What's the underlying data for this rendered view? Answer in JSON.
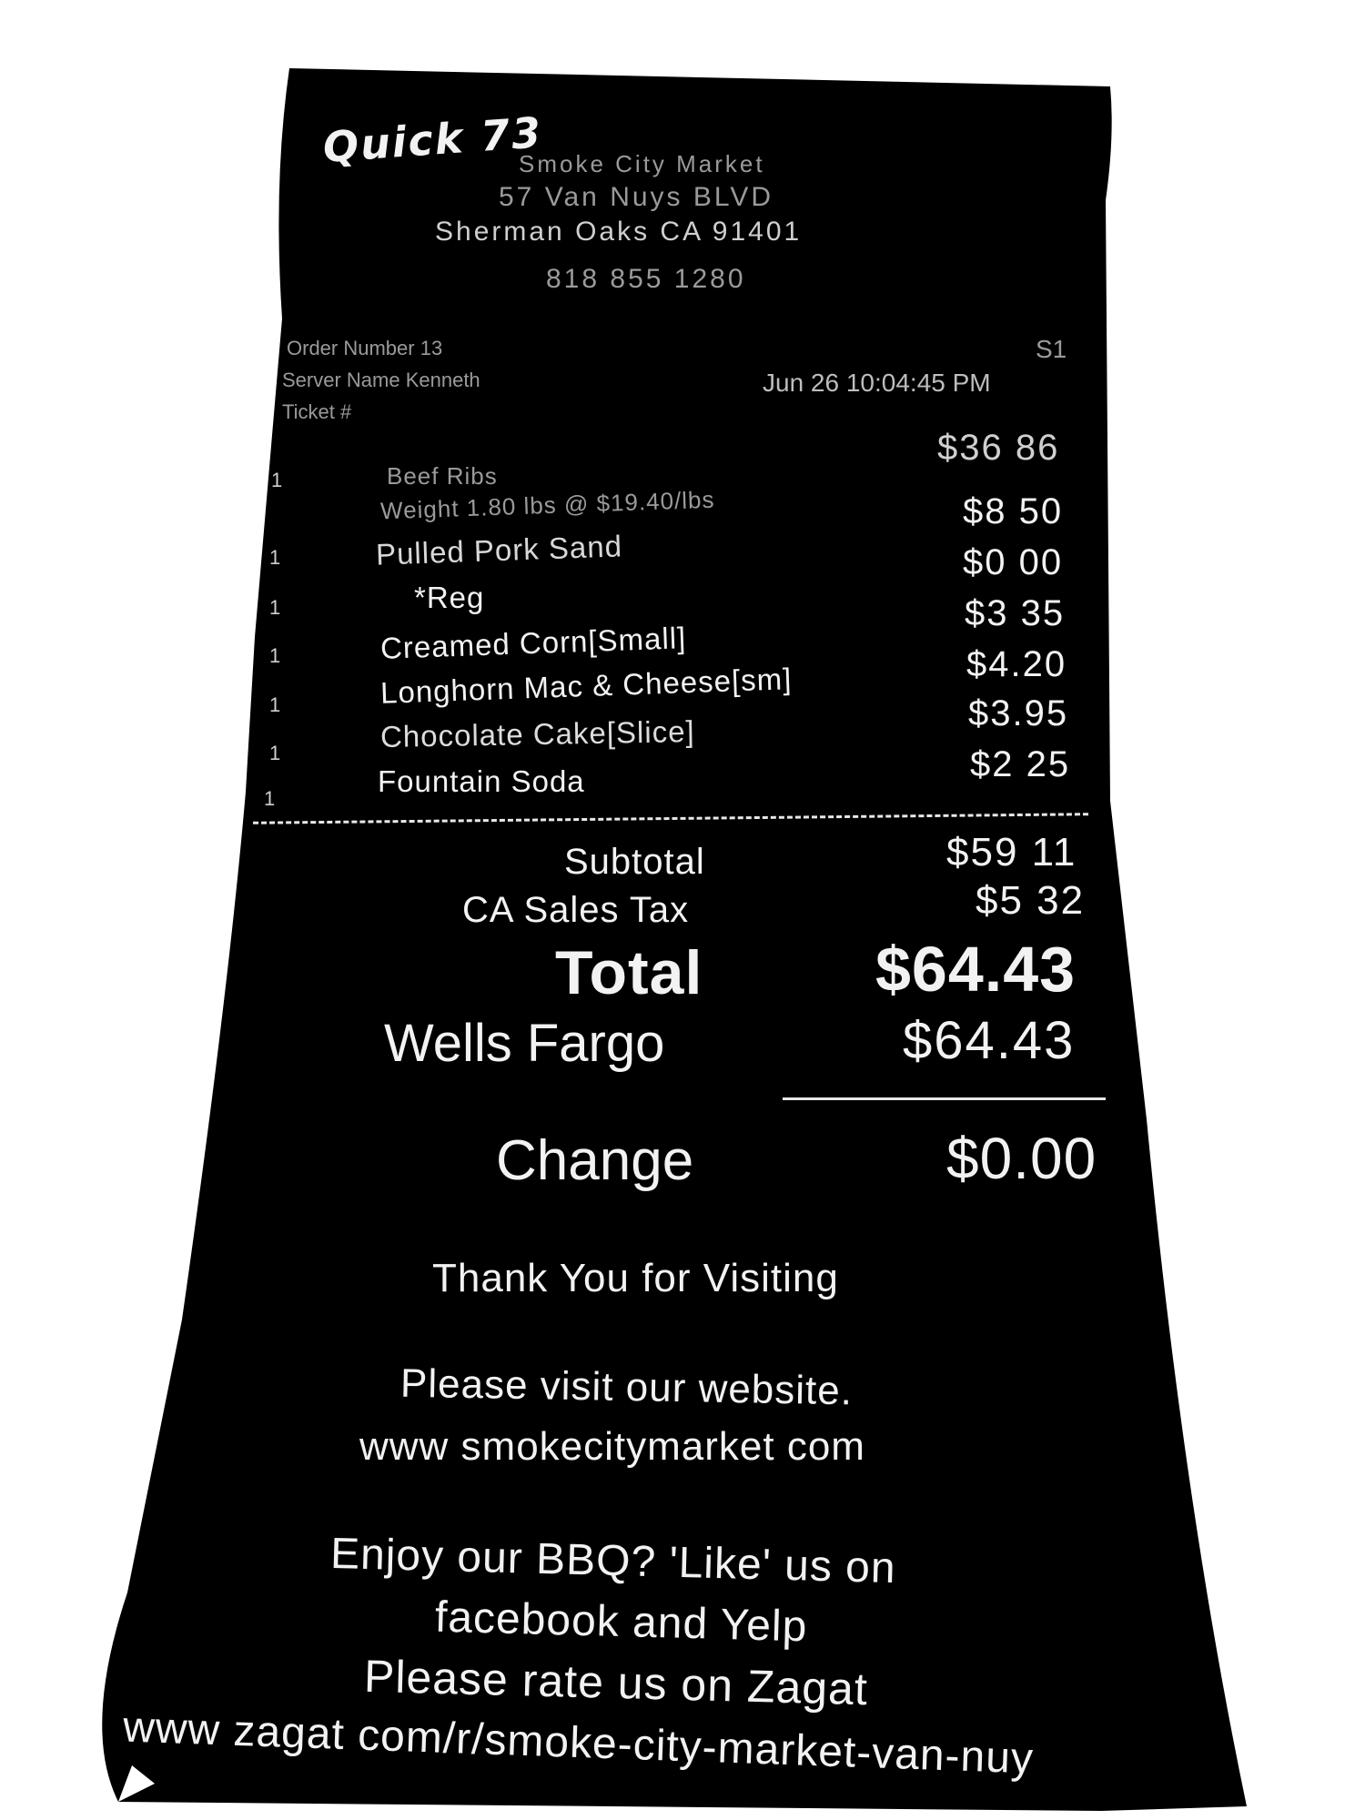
{
  "header": {
    "logo": "Quick 73",
    "store_name": "Smoke City Market",
    "street": "57 Van Nuys BLVD",
    "city_line": "Sherman Oaks CA 91401",
    "phone": "818 855 1280"
  },
  "meta": {
    "line1_left": "Order Number 13",
    "line1_right": "S1",
    "line2_left": "Server Name Kenneth",
    "line2_right": "Jun 26 10:04:45 PM",
    "line3_left": "Ticket #"
  },
  "items": [
    {
      "qty": "1",
      "name": "Beef Ribs",
      "price": "$36 86"
    },
    {
      "qty": "",
      "name": "Weight 1.80 lbs @ $19.40/lbs",
      "price": ""
    },
    {
      "qty": "1",
      "name": "Pulled Pork Sand",
      "price": "$8 50"
    },
    {
      "qty": "1",
      "name": "*Reg",
      "price": "$0 00"
    },
    {
      "qty": "1",
      "name": "Creamed Corn[Small]",
      "price": "$3 35"
    },
    {
      "qty": "1",
      "name": "Longhorn Mac & Cheese[sm]",
      "price": "$4.20"
    },
    {
      "qty": "1",
      "name": "Chocolate Cake[Slice]",
      "price": "$3.95"
    },
    {
      "qty": "1",
      "name": "Fountain Soda",
      "price": "$2 25"
    }
  ],
  "totals": {
    "subtotal_label": "Subtotal",
    "subtotal_value": "$59 11",
    "tax_label": "CA Sales Tax",
    "tax_value": "$5 32",
    "total_label": "Total",
    "total_value": "$64.43",
    "tender_label": "Wells Fargo",
    "tender_value": "$64.43",
    "change_label": "Change",
    "change_value": "$0.00"
  },
  "footer": {
    "thanks": "Thank You for Visiting",
    "visit_line": "Please visit our website.",
    "website": "www smokecitymarket com",
    "bbq_line": "Enjoy our BBQ? 'Like' us on",
    "social_line": "facebook and Yelp",
    "rate_line": "Please rate us on Zagat",
    "zagat_url": "www zagat com/r/smoke-city-market-van-nuy"
  },
  "colors": {
    "paper": "#000000",
    "background": "#ffffff",
    "ink": "#f2f2f2"
  }
}
